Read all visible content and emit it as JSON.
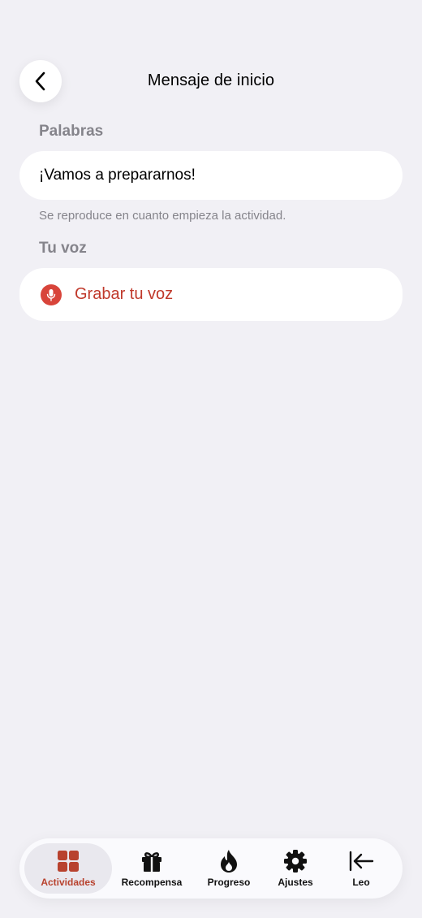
{
  "header": {
    "title": "Mensaje de inicio",
    "back_icon": "chevron-left-icon"
  },
  "words_section": {
    "label": "Palabras",
    "value": "¡Vamos a prepararnos!",
    "hint": "Se reproduce en cuanto empieza la actividad."
  },
  "voice_section": {
    "label": "Tu voz",
    "record_label": "Grabar tu voz",
    "record_icon": "microphone-icon"
  },
  "tabbar": {
    "items": [
      {
        "label": "Actividades",
        "icon": "grid-icon",
        "active": true
      },
      {
        "label": "Recompensa",
        "icon": "gift-icon",
        "active": false
      },
      {
        "label": "Progreso",
        "icon": "flame-icon",
        "active": false
      },
      {
        "label": "Ajustes",
        "icon": "gear-icon",
        "active": false
      },
      {
        "label": "Leo",
        "icon": "arrow-left-bar-icon",
        "active": false
      }
    ]
  },
  "colors": {
    "background": "#f1f0f5",
    "accent": "#b8422e",
    "mic": "#d8443a",
    "secondary_text": "#85848b"
  }
}
